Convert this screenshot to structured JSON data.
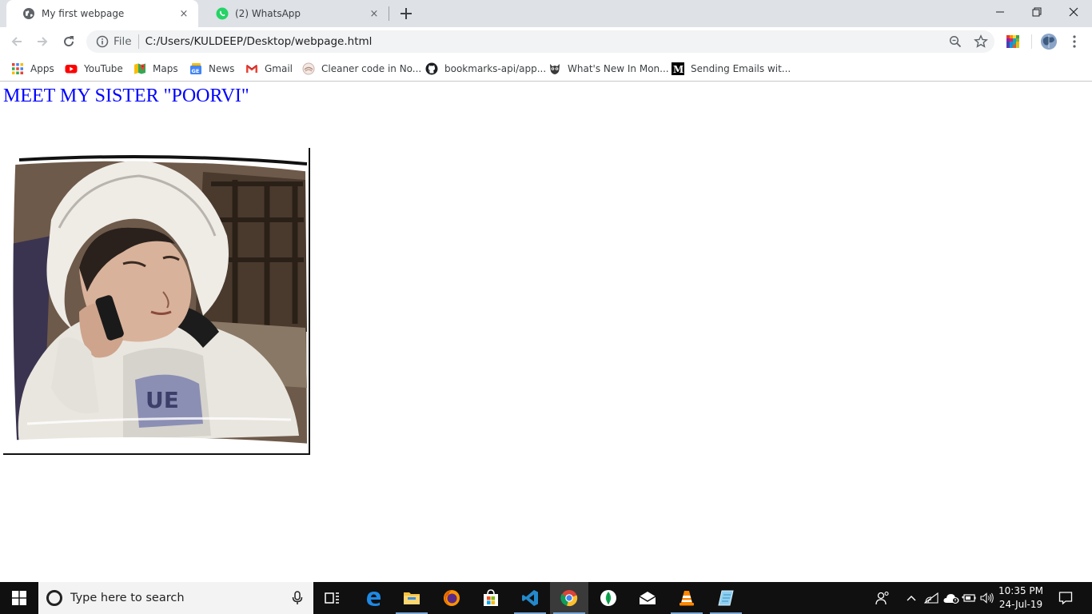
{
  "browser": {
    "tabs": [
      {
        "title": "My first webpage",
        "close": "×",
        "icon": "globe-icon"
      },
      {
        "title": "(2) WhatsApp",
        "close": "×",
        "icon": "whatsapp-icon"
      }
    ],
    "new_tab": "+",
    "omnibox": {
      "scheme_chip": "File",
      "url": "C:/Users/KULDEEP/Desktop/webpage.html"
    },
    "bookmarks": [
      {
        "label": "Apps",
        "icon": "apps-grid-icon"
      },
      {
        "label": "YouTube",
        "icon": "youtube-icon"
      },
      {
        "label": "Maps",
        "icon": "maps-icon"
      },
      {
        "label": "News",
        "icon": "google-news-icon"
      },
      {
        "label": "Gmail",
        "icon": "gmail-icon"
      },
      {
        "label": "Cleaner code in No...",
        "icon": "cleaner-code-icon"
      },
      {
        "label": "bookmarks-api/app...",
        "icon": "github-icon"
      },
      {
        "label": "What's New In Mon...",
        "icon": "owl-icon"
      },
      {
        "label": "Sending Emails wit...",
        "icon": "medium-icon"
      }
    ]
  },
  "page": {
    "heading": "MEET MY SISTER \"POORVI\""
  },
  "taskbar": {
    "search_placeholder": "Type here to search",
    "clock_time": "10:35 PM",
    "clock_date": "24-Jul-19"
  },
  "colors": {
    "heading": "#0000ff",
    "tabstrip": "#dee1e6",
    "taskbar": "#101010"
  }
}
